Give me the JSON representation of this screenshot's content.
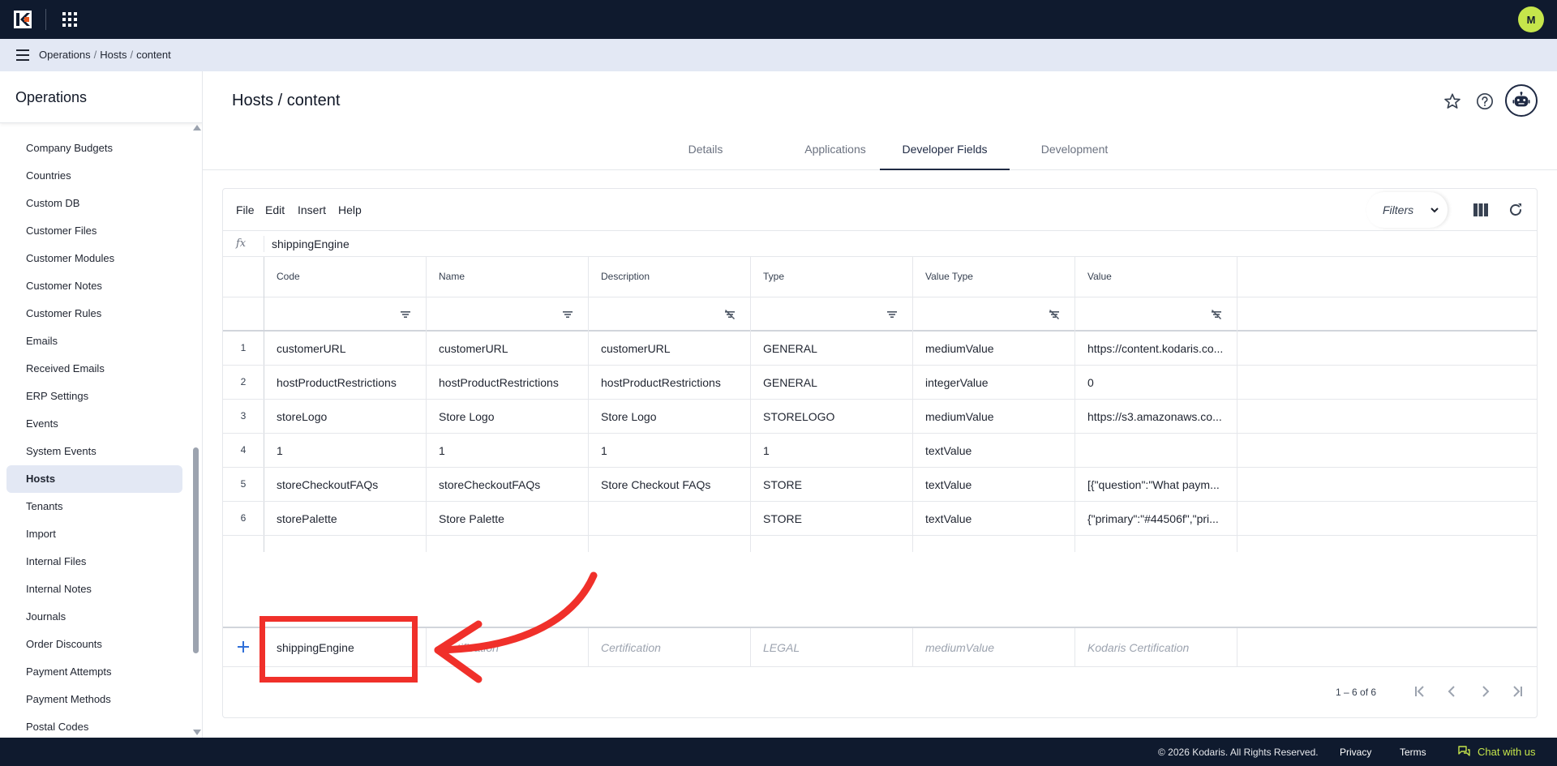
{
  "app": {
    "user_initial": "M"
  },
  "breadcrumb": {
    "items": [
      "Operations",
      "Hosts",
      "content"
    ],
    "sep": "/"
  },
  "sidebar": {
    "title": "Operations",
    "items": [
      {
        "label": "Company Budgets"
      },
      {
        "label": "Countries"
      },
      {
        "label": "Custom DB"
      },
      {
        "label": "Customer Files"
      },
      {
        "label": "Customer Modules"
      },
      {
        "label": "Customer Notes"
      },
      {
        "label": "Customer Rules"
      },
      {
        "label": "Emails"
      },
      {
        "label": "Received Emails"
      },
      {
        "label": "ERP Settings"
      },
      {
        "label": "Events"
      },
      {
        "label": "System Events"
      },
      {
        "label": "Hosts",
        "active": true
      },
      {
        "label": "Tenants"
      },
      {
        "label": "Import"
      },
      {
        "label": "Internal Files"
      },
      {
        "label": "Internal Notes"
      },
      {
        "label": "Journals"
      },
      {
        "label": "Order Discounts"
      },
      {
        "label": "Payment Attempts"
      },
      {
        "label": "Payment Methods"
      },
      {
        "label": "Postal Codes"
      }
    ]
  },
  "page": {
    "title": "Hosts / content"
  },
  "tabs": [
    {
      "label": "Details"
    },
    {
      "label": "Applications"
    },
    {
      "label": "Developer Fields",
      "active": true
    },
    {
      "label": "Development"
    }
  ],
  "toolbar": {
    "menu": [
      "File",
      "Edit",
      "Insert",
      "Help"
    ],
    "filters_label": "Filters"
  },
  "formula": {
    "fx_label": "fx",
    "value": "shippingEngine"
  },
  "grid": {
    "columns": [
      "Code",
      "Name",
      "Description",
      "Type",
      "Value Type",
      "Value"
    ],
    "rows": [
      {
        "num": "1",
        "cells": [
          "customerURL",
          "customerURL",
          "customerURL",
          "GENERAL",
          "mediumValue",
          "https://content.kodaris.co..."
        ]
      },
      {
        "num": "2",
        "cells": [
          "hostProductRestrictions",
          "hostProductRestrictions",
          "hostProductRestrictions",
          "GENERAL",
          "integerValue",
          "0"
        ]
      },
      {
        "num": "3",
        "cells": [
          "storeLogo",
          "Store Logo",
          "Store Logo",
          "STORELOGO",
          "mediumValue",
          "https://s3.amazonaws.co..."
        ]
      },
      {
        "num": "4",
        "cells": [
          "1",
          "1",
          "1",
          "1",
          "textValue",
          ""
        ]
      },
      {
        "num": "5",
        "cells": [
          "storeCheckoutFAQs",
          "storeCheckoutFAQs",
          "Store Checkout FAQs",
          "STORE",
          "textValue",
          "[{\"question\":\"What paym..."
        ]
      },
      {
        "num": "6",
        "cells": [
          "storePalette",
          "Store Palette",
          "",
          "STORE",
          "textValue",
          "{\"primary\":\"#44506f\",\"pri..."
        ]
      }
    ],
    "new_row": {
      "code": "shippingEngine",
      "name_placeholder": "Certification",
      "description_placeholder": "Certification",
      "type_placeholder": "LEGAL",
      "value_type_placeholder": "mediumValue",
      "value_placeholder": "Kodaris Certification"
    },
    "pager": {
      "range": "1 – 6 of 6"
    }
  },
  "footer": {
    "copyright": "© 2026 Kodaris. All Rights Reserved.",
    "privacy": "Privacy",
    "terms": "Terms",
    "chat": "Chat with us"
  },
  "colors": {
    "topbar": "#0f1a2e",
    "accent": "#1f2a44",
    "avatar": "#c5e54b",
    "annotation": "#f0302a",
    "add_icon": "#2f6fd8"
  }
}
